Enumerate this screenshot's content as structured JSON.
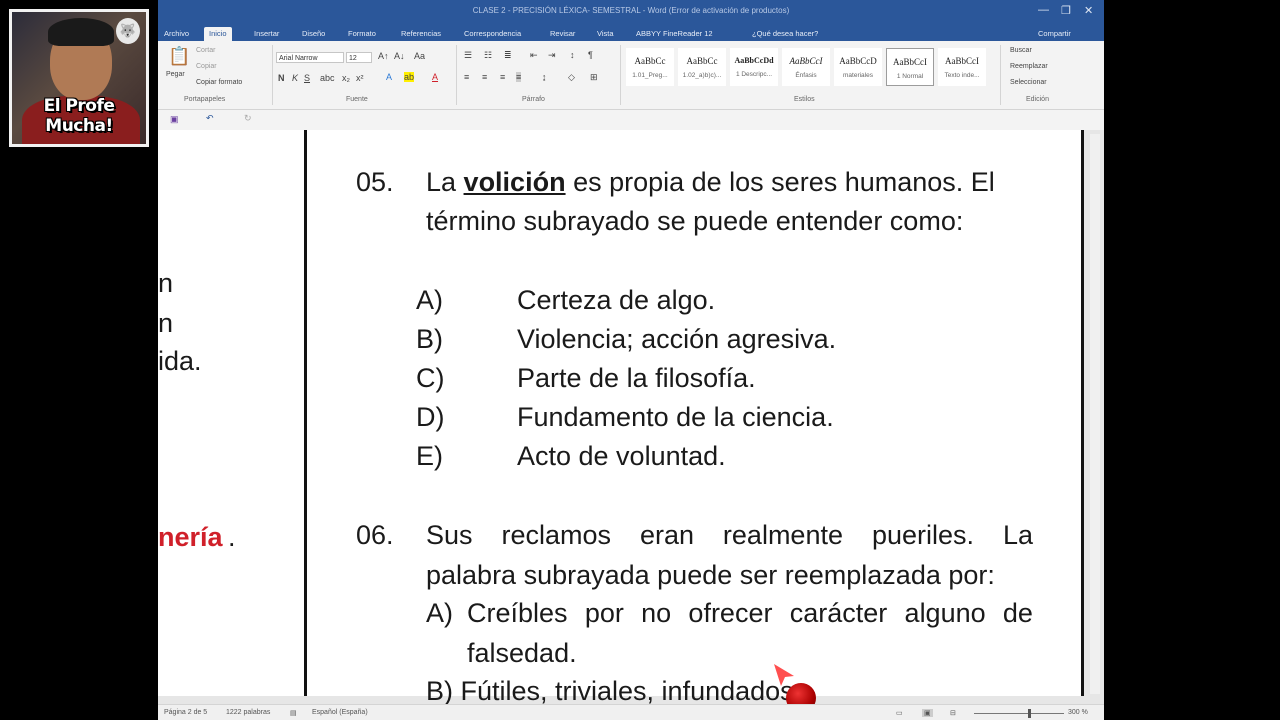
{
  "overlay": {
    "caption": "El Profe Mucha!",
    "badge_icon": "wolf-crest-icon"
  },
  "window": {
    "title": "CLASE 2 - PRECISIÓN LÉXICA- SEMESTRAL - Word (Error de activación de productos)",
    "controls": [
      "—",
      "❐",
      "✕"
    ]
  },
  "tabs": [
    "Archivo",
    "Inicio",
    "Insertar",
    "Diseño",
    "Formato",
    "Referencias",
    "Correspondencia",
    "Revisar",
    "Vista",
    "ABBYY FineReader 12",
    "¿Qué desea hacer?"
  ],
  "share_label": "Compartir",
  "ribbon": {
    "clipboard": {
      "paste": "Pegar",
      "cut": "Cortar",
      "copy": "Copiar",
      "format_painter": "Copiar formato",
      "group": "Portapapeles"
    },
    "font": {
      "name": "Arial Narrow",
      "size": "12",
      "group": "Fuente"
    },
    "paragraph": {
      "group": "Párrafo"
    },
    "styles": {
      "group": "Estilos",
      "items": [
        {
          "preview": "AaBbCc",
          "label": "1.01_Preg..."
        },
        {
          "preview": "AaBbCc",
          "label": "1.02_a)b)c)..."
        },
        {
          "preview": "AaBbCcDd",
          "label": "1 Descripc..."
        },
        {
          "preview": "AaBbCcI",
          "label": "Énfasis"
        },
        {
          "preview": "AaBbCcD",
          "label": "materiales"
        },
        {
          "preview": "AaBbCcI",
          "label": "1 Normal"
        },
        {
          "preview": "AaBbCcI",
          "label": "Texto inde..."
        }
      ]
    },
    "editing": {
      "find": "Buscar",
      "replace": "Reemplazar",
      "select": "Seleccionar",
      "group": "Edición"
    }
  },
  "status": {
    "page": "Página 2 de 5",
    "words": "1222 palabras",
    "language": "Español (España)",
    "zoom": "300 %"
  },
  "left_page_fragments": [
    "n",
    "n",
    "ida.",
    "nería",
    "."
  ],
  "questions": [
    {
      "number": "05.",
      "line1_before": "La ",
      "line1_keyword": "volición",
      "line1_after": " es propia de los seres humanos. El",
      "line2": "término subrayado se puede entender como:",
      "options": [
        {
          "letter": "A)",
          "text": "Certeza de algo."
        },
        {
          "letter": "B)",
          "text": "Violencia; acción agresiva."
        },
        {
          "letter": "C)",
          "text": "Parte de la filosofía."
        },
        {
          "letter": "D)",
          "text": "Fundamento de la ciencia."
        },
        {
          "letter": "E)",
          "text": "Acto de voluntad."
        }
      ]
    },
    {
      "number": "06.",
      "line1_words": [
        "Sus",
        "reclamos",
        "eran",
        "realmente",
        "pueriles.",
        "La"
      ],
      "line2": "palabra subrayada puede ser reemplazada por:",
      "optionA_letter": "A)",
      "optionA_line1_words": [
        "Creíbles",
        "por",
        "no",
        "ofrecer",
        "carácter",
        "alguno",
        "de"
      ],
      "optionA_line2": "falsedad.",
      "optionB_partial": "B) Fútiles, triviales, infundados."
    }
  ],
  "colors": {
    "word_blue": "#2b579a",
    "highlight_red": "#d0202a"
  }
}
